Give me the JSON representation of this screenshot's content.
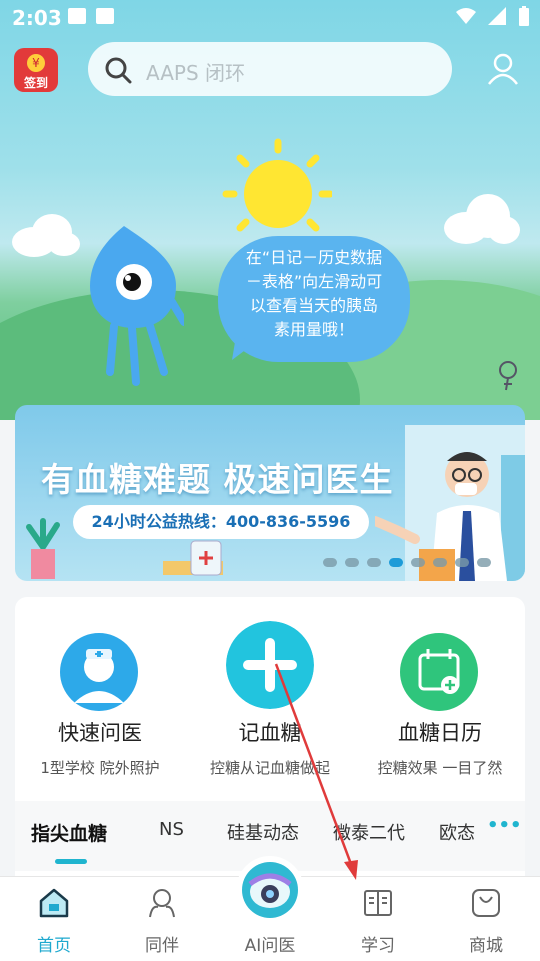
{
  "status_bar": {
    "time": "2:03"
  },
  "header": {
    "checkin_label": "签到",
    "checkin_coin": "¥",
    "search_placeholder": "AAPS 闭环"
  },
  "hero": {
    "tip_lines": [
      "在“日记－历史数据",
      "－表格”向左滑动可",
      "以查看当天的胰岛",
      "素用量哦！"
    ]
  },
  "banner": {
    "title": "有血糖难题 极速问医生",
    "hotline": "24小时公益热线：400-836-5596",
    "slide_count": 8,
    "active_slide": 4
  },
  "quick_actions": [
    {
      "label": "快速问医",
      "subtitle": "1型学校 院外照护",
      "icon": "doctor-icon"
    },
    {
      "label": "记血糖",
      "subtitle": "控糖从记血糖做起",
      "icon": "plus-icon"
    },
    {
      "label": "血糖日历",
      "subtitle": "控糖效果 一目了然",
      "icon": "calendar-icon"
    }
  ],
  "category_tabs": {
    "items": [
      "指尖血糖",
      "NS",
      "硅基动态",
      "微泰二代",
      "欧态"
    ],
    "active": "指尖血糖",
    "more": "•••"
  },
  "bottom_nav": [
    {
      "label": "首页",
      "icon": "home-icon",
      "active": true
    },
    {
      "label": "同伴",
      "icon": "companion-icon",
      "active": false
    },
    {
      "label": "AI问医",
      "icon": "ai-doctor-icon",
      "active": false
    },
    {
      "label": "学习",
      "icon": "book-icon",
      "active": false
    },
    {
      "label": "商城",
      "icon": "shop-bag-icon",
      "active": false
    }
  ],
  "colors": {
    "accent": "#1fa9cf",
    "checkin_red": "#e23a3a",
    "arrow_red": "#e03b3b"
  }
}
